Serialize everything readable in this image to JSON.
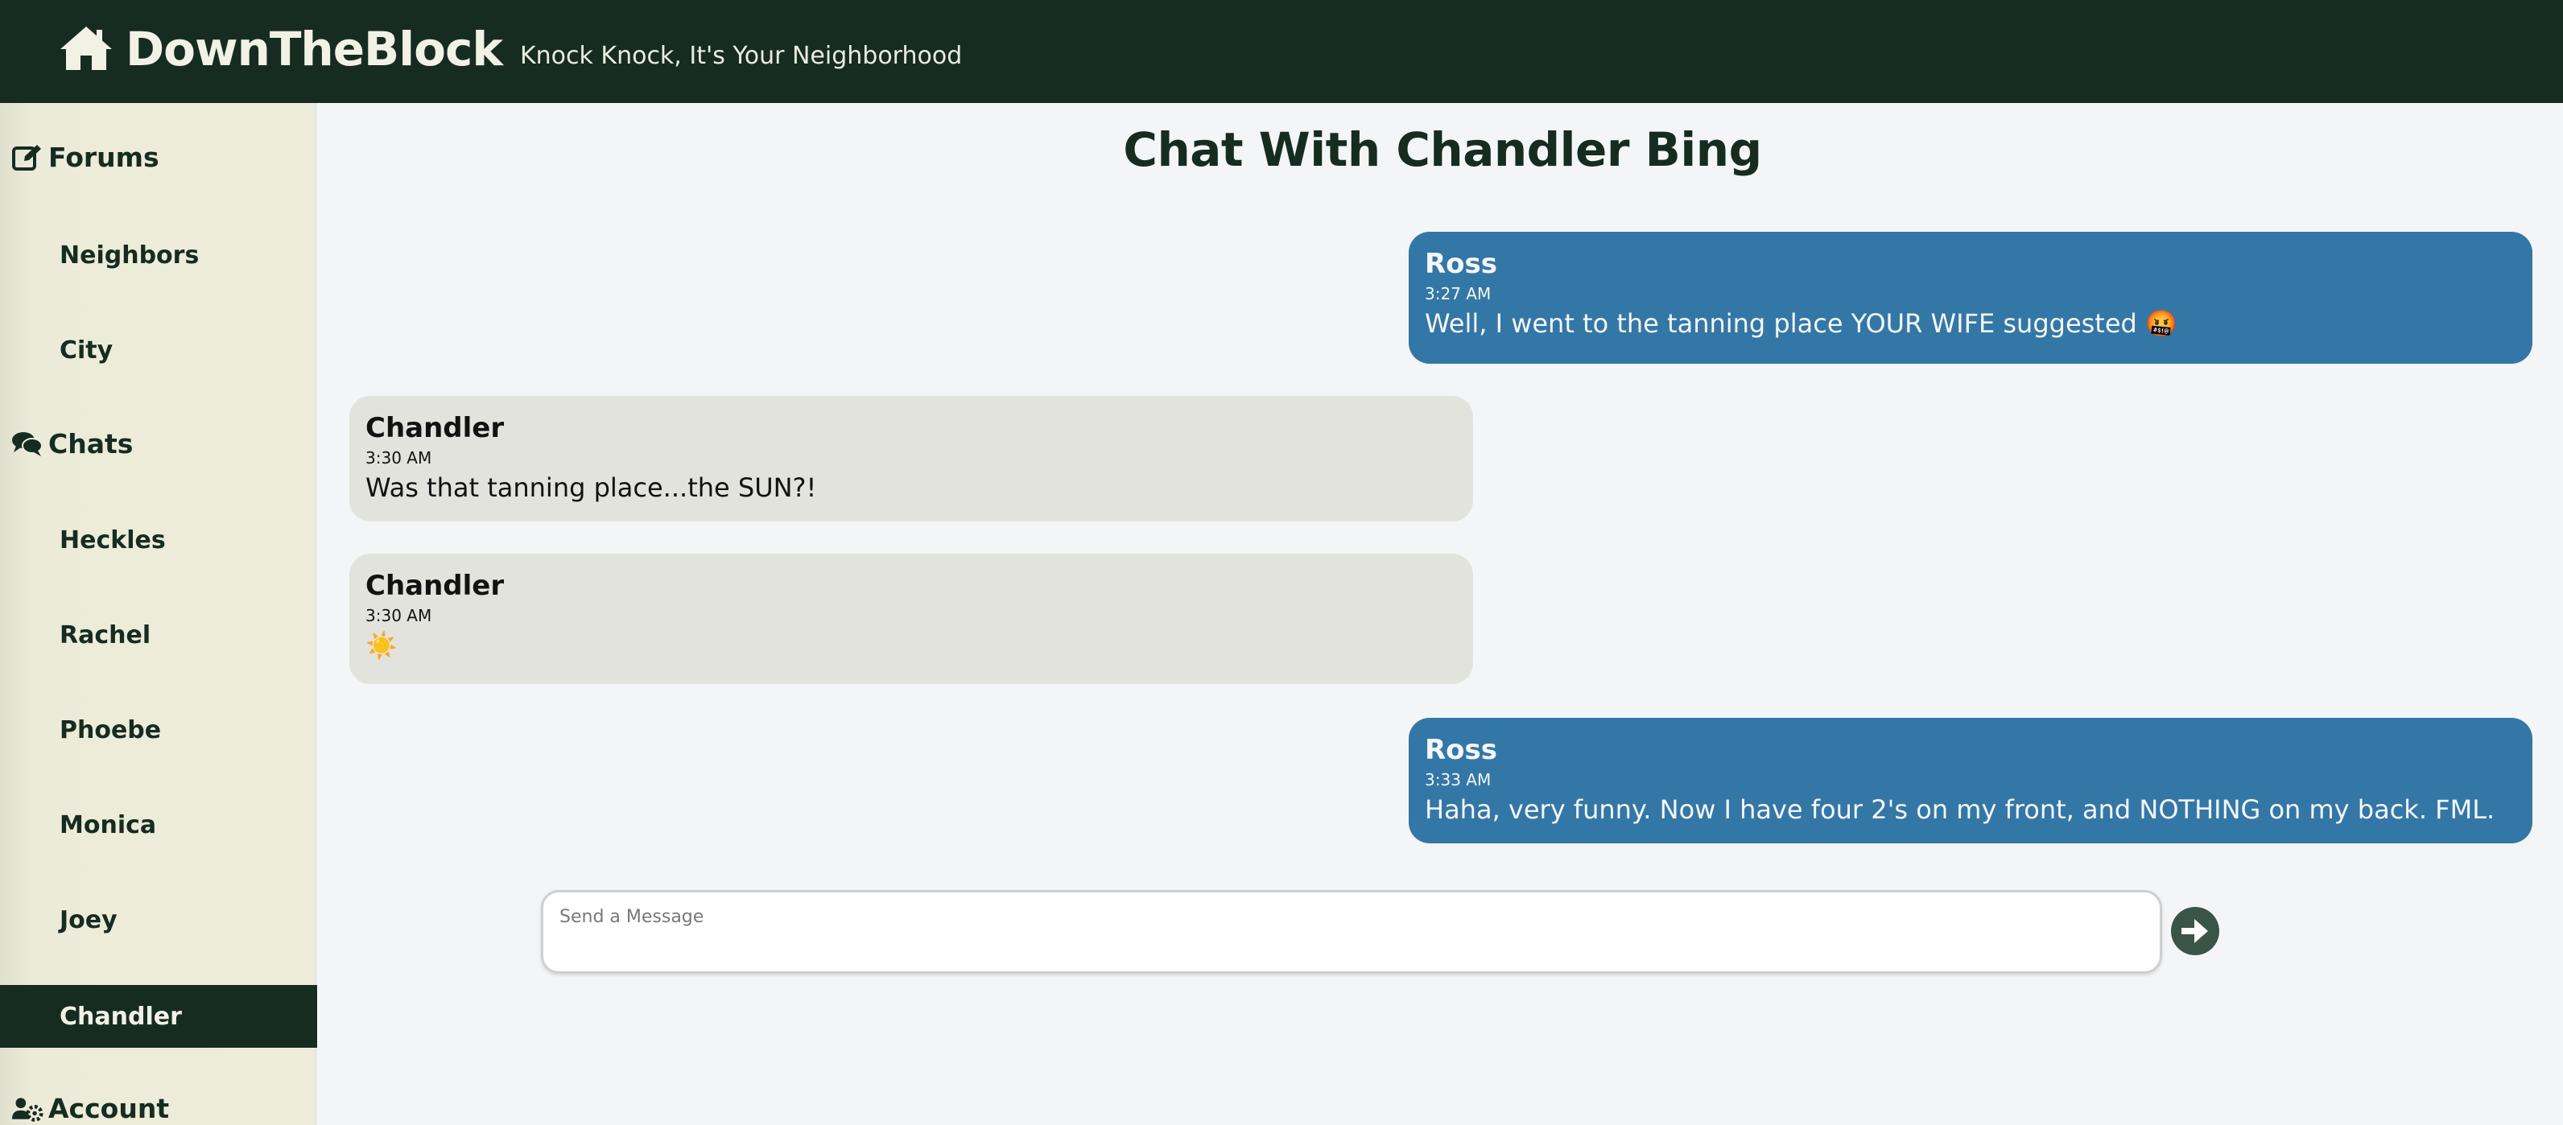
{
  "header": {
    "brand": "DownTheBlock",
    "tagline": "Knock Knock, It's Your Neighborhood",
    "logo_icon": "home-icon"
  },
  "sidebar": {
    "forums": {
      "label": "Forums",
      "icon": "edit-icon",
      "items": [
        {
          "label": "Neighbors"
        },
        {
          "label": "City"
        }
      ]
    },
    "chats": {
      "label": "Chats",
      "icon": "comments-icon",
      "items": [
        {
          "label": "Heckles"
        },
        {
          "label": "Rachel"
        },
        {
          "label": "Phoebe"
        },
        {
          "label": "Monica"
        },
        {
          "label": "Joey"
        },
        {
          "label": "Chandler",
          "active": true
        }
      ]
    },
    "account": {
      "label": "Account",
      "icon": "users-cog-icon"
    }
  },
  "chat": {
    "title": "Chat With Chandler Bing",
    "messages": [
      {
        "sender": "Ross",
        "time": "3:27 AM",
        "text": "Well, I went to the tanning place YOUR WIFE suggested 🤬",
        "mine": true
      },
      {
        "sender": "Chandler",
        "time": "3:30 AM",
        "text": "Was that tanning place...the SUN?!",
        "mine": false
      },
      {
        "sender": "Chandler",
        "time": "3:30 AM",
        "text": "☀️",
        "mine": false
      },
      {
        "sender": "Ross",
        "time": "3:33 AM",
        "text": "Haha, very funny. Now I have four 2's on my front, and NOTHING on my back. FML.",
        "mine": true
      }
    ]
  },
  "composer": {
    "placeholder": "Send a Message",
    "value": "",
    "send_icon": "arrow-circle-right-icon"
  },
  "colors": {
    "header_bg": "#162c21",
    "sidebar_bg": "#eeedda",
    "mine_bubble": "#3377a6",
    "their_bubble": "#e3e3de",
    "send_button": "#3a5447"
  }
}
